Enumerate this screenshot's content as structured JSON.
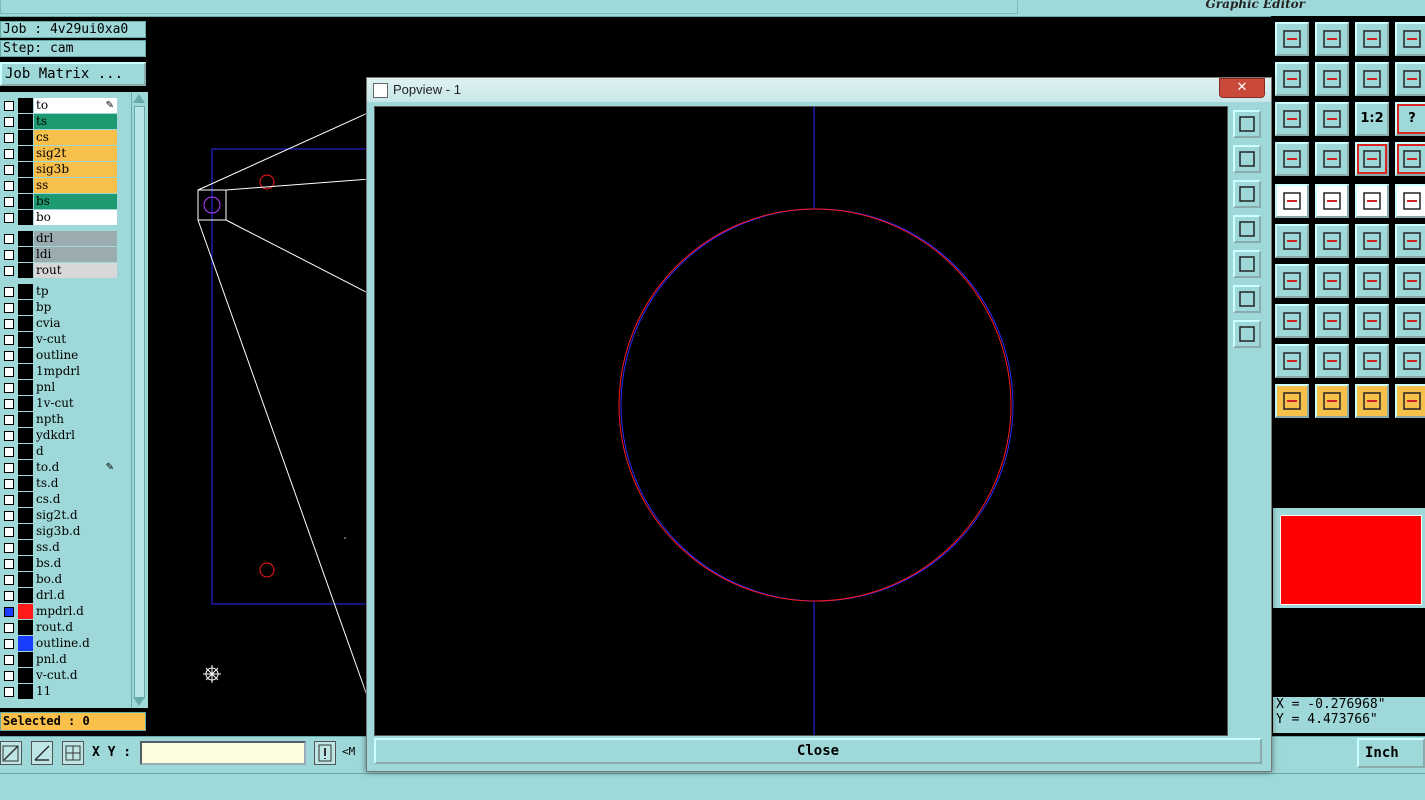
{
  "app": {
    "title": "Graphic Editor"
  },
  "job": {
    "label": "Job : 4v29ui0xa0",
    "step": "Step: cam",
    "matrix_button": "Job Matrix ..."
  },
  "layers_board": [
    {
      "name": "to",
      "color": "#ffffff",
      "flag": "pencil"
    },
    {
      "name": "ts",
      "color": "#1e9a72"
    },
    {
      "name": "cs",
      "color": "#f7c04a"
    },
    {
      "name": "sig2t",
      "color": "#f7c04a"
    },
    {
      "name": "sig3b",
      "color": "#f7c04a"
    },
    {
      "name": "ss",
      "color": "#f7c04a"
    },
    {
      "name": "bs",
      "color": "#1e9a72"
    },
    {
      "name": "bo",
      "color": "#ffffff"
    }
  ],
  "layers_drill": [
    {
      "name": "drl",
      "color": "#9aacb0"
    },
    {
      "name": "ldi",
      "color": "#9aacb0"
    },
    {
      "name": "rout",
      "color": "#d8d8d8"
    }
  ],
  "layers_misc": [
    {
      "name": "tp"
    },
    {
      "name": "bp"
    },
    {
      "name": "cvia"
    },
    {
      "name": "v-cut"
    },
    {
      "name": "outline"
    },
    {
      "name": "1mpdrl"
    },
    {
      "name": "pnl"
    },
    {
      "name": "1v-cut"
    },
    {
      "name": "npth"
    },
    {
      "name": "ydkdrl"
    },
    {
      "name": "d"
    },
    {
      "name": "to.d",
      "flag": "pencil"
    },
    {
      "name": "ts.d"
    },
    {
      "name": "cs.d"
    },
    {
      "name": "sig2t.d"
    },
    {
      "name": "sig3b.d"
    },
    {
      "name": "ss.d"
    },
    {
      "name": "bs.d"
    },
    {
      "name": "bo.d"
    },
    {
      "name": "drl.d"
    },
    {
      "name": "mpdrl.d",
      "swatch": "#ff1a1a",
      "bg": "#ff1a1a",
      "checked": true
    },
    {
      "name": "rout.d"
    },
    {
      "name": "outline.d",
      "swatch": "#1a3cff"
    },
    {
      "name": "pnl.d"
    },
    {
      "name": "v-cut.d"
    },
    {
      "name": "11"
    }
  ],
  "selected": "Selected : 0",
  "bottom": {
    "xy_label": "X Y :",
    "xy_value": "",
    "mode_text": "<M",
    "unit": "Inch"
  },
  "coords": {
    "x": "X = -0.276968\"",
    "y": "Y = 4.473766\""
  },
  "popview": {
    "title": "Popview - 1",
    "close_label": "Close",
    "close_x": "✕"
  },
  "colors": {
    "panel": "#9fd8d8",
    "board_outline": "#2a2aff",
    "feature_red": "#ff1a1a",
    "canvas": "#000000"
  }
}
